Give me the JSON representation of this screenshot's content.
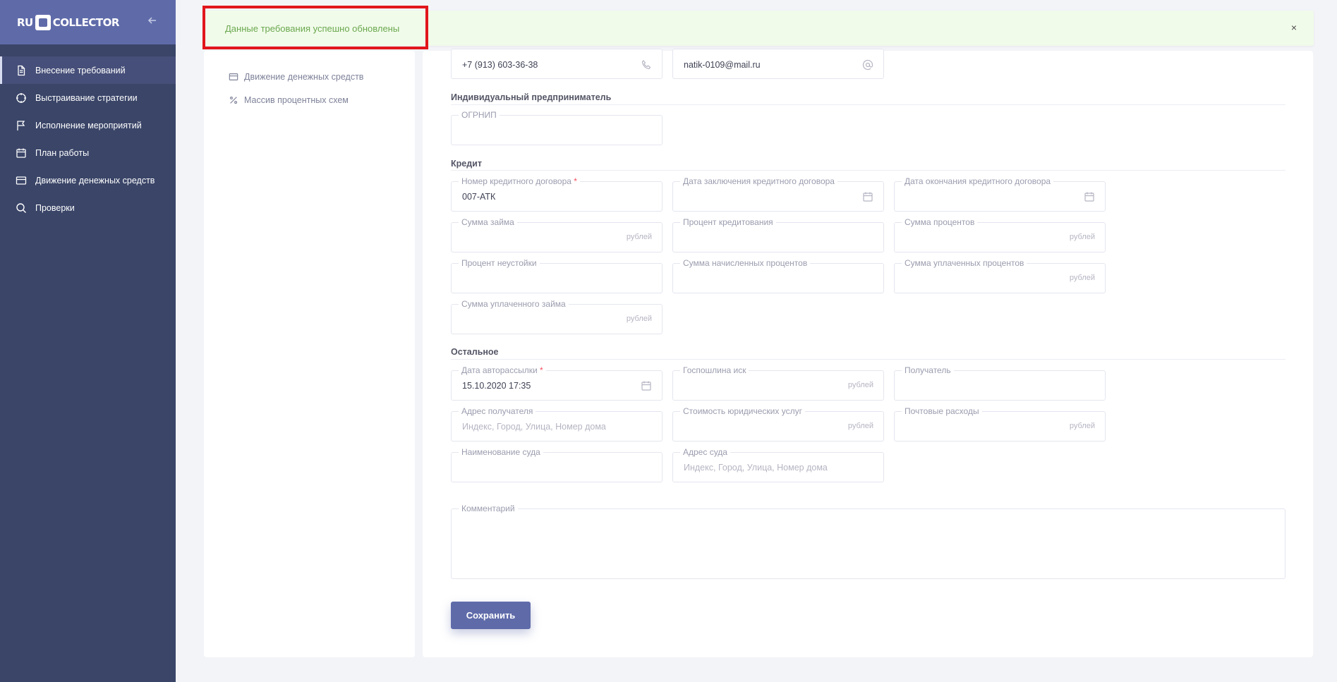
{
  "app": {
    "logo_left": "RU",
    "logo_right": "COLLECTOR",
    "collapse_icon": "arrow-left-icon"
  },
  "sidebar": {
    "items": [
      {
        "label": "Внесение требований",
        "icon": "document-icon",
        "active": true
      },
      {
        "label": "Выстраивание стратегии",
        "icon": "crosshair-icon"
      },
      {
        "label": "Исполнение мероприятий",
        "icon": "flag-icon"
      },
      {
        "label": "План работы",
        "icon": "calendar-icon"
      },
      {
        "label": "Движение денежных средств",
        "icon": "card-icon"
      },
      {
        "label": "Проверки",
        "icon": "search-icon"
      }
    ]
  },
  "left_panel": {
    "items": [
      {
        "label": "Движение денежных средств",
        "icon": "card-icon"
      },
      {
        "label": "Массив процентных схем",
        "icon": "percent-icon"
      }
    ]
  },
  "toast": {
    "message": "Данные требования успешно обновлены",
    "close": "×"
  },
  "contact": {
    "phone_value": "+7 (913) 603-36-38",
    "email_value": "natik-0109@mail.ru"
  },
  "ip_section": {
    "title": "Индивидуальный предприниматель",
    "ogrnip_label": "ОГРНИП"
  },
  "credit_section": {
    "title": "Кредит",
    "contract_number_label": "Номер кредитного договора",
    "contract_number_value": "007-АТК",
    "contract_date_label": "Дата заключения кредитного договора",
    "contract_end_label": "Дата окончания кредитного договора",
    "loan_sum_label": "Сумма займа",
    "credit_percent_label": "Процент кредитования",
    "percent_sum_label": "Сумма процентов",
    "penalty_percent_label": "Процент неустойки",
    "accrued_percent_label": "Сумма начисленных процентов",
    "paid_percent_label": "Сумма уплаченных процентов",
    "paid_loan_label": "Сумма уплаченного займа",
    "currency_suffix": "рублей"
  },
  "other_section": {
    "title": "Остальное",
    "autosend_label": "Дата авторассылки",
    "autosend_value": "15.10.2020 17:35",
    "duty_label": "Госпошлина иск",
    "recipient_label": "Получатель",
    "recipient_address_label": "Адрес получателя",
    "address_placeholder": "Индекс, Город, Улица, Номер дома",
    "legal_cost_label": "Стоимость юридических услуг",
    "postal_label": "Почтовые расходы",
    "court_name_label": "Наименование суда",
    "court_address_label": "Адрес суда",
    "comment_label": "Комментарий"
  },
  "actions": {
    "save_label": "Сохранить"
  },
  "colors": {
    "accent": "#5f6ba9",
    "sidebar": "#3a4568",
    "success_bg": "#f1fbea",
    "success_text": "#6aa84f",
    "highlight": "#e1161c"
  }
}
